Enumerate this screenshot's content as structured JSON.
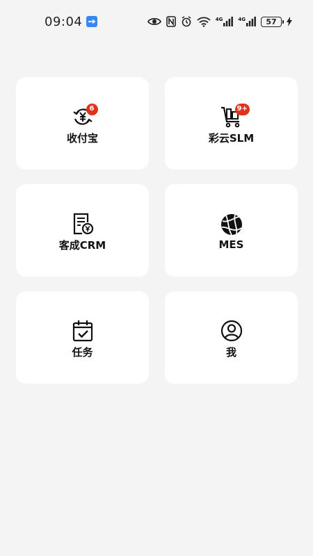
{
  "status_bar": {
    "time": "09:04",
    "network_1": "4G",
    "network_2": "4G",
    "battery": "57"
  },
  "apps": [
    {
      "label": "收付宝",
      "badge": "6",
      "icon": "currency-exchange-icon"
    },
    {
      "label": "彩云SLM",
      "badge": "9+",
      "icon": "cart-icon"
    },
    {
      "label": "客成CRM",
      "badge": "",
      "icon": "invoice-icon"
    },
    {
      "label": "MES",
      "badge": "",
      "icon": "globe-icon"
    },
    {
      "label": "任务",
      "badge": "",
      "icon": "calendar-check-icon"
    },
    {
      "label": "我",
      "badge": "",
      "icon": "user-icon"
    }
  ],
  "colors": {
    "background": "#f4f4f4",
    "card": "#ffffff",
    "badge": "#e0321d",
    "usb_badge": "#3a86f0"
  }
}
